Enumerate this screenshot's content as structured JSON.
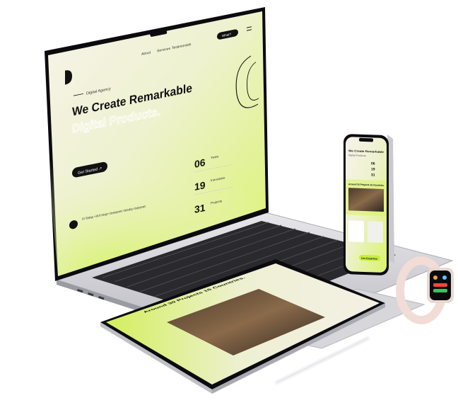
{
  "scene": {
    "description_free": true,
    "colors": {
      "accent": "#d9f36a",
      "accent_strong": "#c6ee3a",
      "cream": "#f7f3ea",
      "dark": "#111111",
      "device_silver": "#c9c9cf",
      "bezel": "#0b0b0f"
    }
  },
  "laptop": {
    "nav": {
      "items": [
        "About",
        "Services",
        "Testimonials"
      ],
      "cta": "What?"
    },
    "hero": {
      "kicker": "Digital Agency",
      "title_line1": "We Create Remarkable",
      "title_line2": "Digital Products.",
      "button": "Get Started ↗"
    },
    "stats": [
      {
        "value": "06",
        "label": "Years"
      },
      {
        "value": "19",
        "label": "Innovative"
      },
      {
        "value": "31",
        "label": "Projects"
      }
    ],
    "footer_text": "UX Strategy • UI/UX Design • Development • Branding • Deployment"
  },
  "phone": {
    "title": "We Create Remarkable",
    "subtitle": "Digital Products.",
    "section": "Around 30 Projects 15 Countries",
    "stats": [
      "06",
      "19",
      "31"
    ],
    "cta": "Our Expertise"
  },
  "tablet": {
    "title": "Around 30 Projects 15 Countries."
  }
}
